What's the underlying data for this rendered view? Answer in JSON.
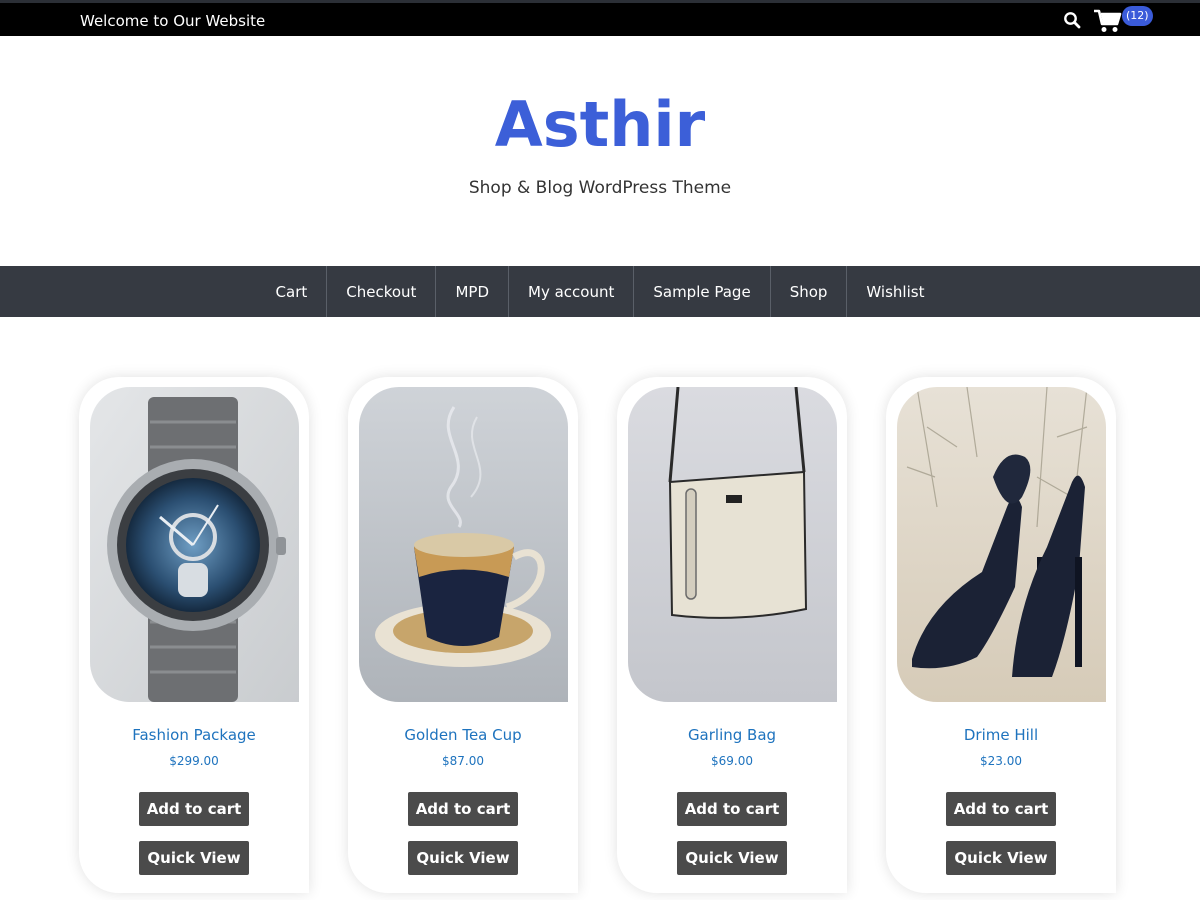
{
  "topbar": {
    "welcome": "Welcome to Our Website",
    "search_icon": "search-icon",
    "cart_icon": "shopping-cart-icon",
    "cart_count": "(12)"
  },
  "header": {
    "site_title": "Asthir",
    "tagline": "Shop & Blog WordPress Theme"
  },
  "nav": {
    "items": [
      "Cart",
      "Checkout",
      "MPD",
      "My account",
      "Sample Page",
      "Shop",
      "Wishlist"
    ]
  },
  "products": [
    {
      "name": "Fashion Package",
      "price": "$299.00",
      "add_to_cart": "Add to cart",
      "quick_view": "Quick View"
    },
    {
      "name": "Golden Tea Cup",
      "price": "$87.00",
      "add_to_cart": "Add to cart",
      "quick_view": "Quick View"
    },
    {
      "name": "Garling Bag",
      "price": "$69.00",
      "add_to_cart": "Add to cart",
      "quick_view": "Quick View"
    },
    {
      "name": "Drime Hill",
      "price": "$23.00",
      "add_to_cart": "Add to cart",
      "quick_view": "Quick View"
    }
  ],
  "colors": {
    "brand": "#3c5fd8",
    "nav_bg": "#363a42",
    "link": "#1e73be",
    "button": "#4b4b4b",
    "badge": "#3a5bd9"
  }
}
